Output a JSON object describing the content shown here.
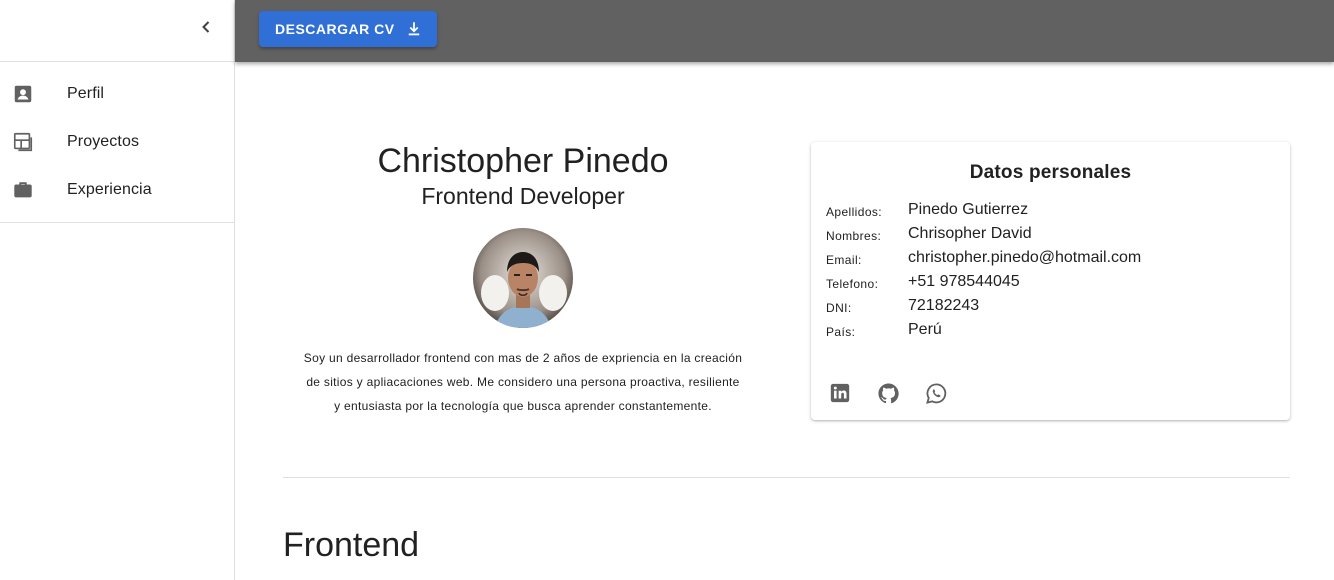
{
  "sidebar": {
    "items": [
      {
        "label": "Perfil",
        "icon": "account-box-icon"
      },
      {
        "label": "Proyectos",
        "icon": "dashboard-layout-icon"
      },
      {
        "label": "Experiencia",
        "icon": "briefcase-icon"
      }
    ]
  },
  "toolbar": {
    "download_label": "DESCARGAR CV"
  },
  "profile": {
    "name": "Christopher Pinedo",
    "role": "Frontend Developer",
    "bio_lines": [
      "Soy un desarrollador frontend con mas de 2 años de exprienci​a en la creación",
      "de sitios y apliacaciones web. Me considero una persona proactiva, resiliente",
      "y entusiasta por la tecnología que busca aprender constantemente."
    ]
  },
  "personal": {
    "title": "Datos personales",
    "rows": [
      {
        "label": "Apellidos:",
        "value": "Pinedo Gutierrez"
      },
      {
        "label": "Nombres:",
        "value": "Chrisopher David"
      },
      {
        "label": "Email:",
        "value": "christopher.pinedo@hotmail.com"
      },
      {
        "label": "Telefono:",
        "value": "+51 978544045"
      },
      {
        "label": "DNI:",
        "value": "72182243"
      },
      {
        "label": "País:",
        "value": "Perú"
      }
    ],
    "socials": [
      "linkedin-icon",
      "github-icon",
      "whatsapp-icon"
    ]
  },
  "section": {
    "title": "Frontend"
  },
  "colors": {
    "accent": "#2f6fd6",
    "topbar": "#616161"
  }
}
